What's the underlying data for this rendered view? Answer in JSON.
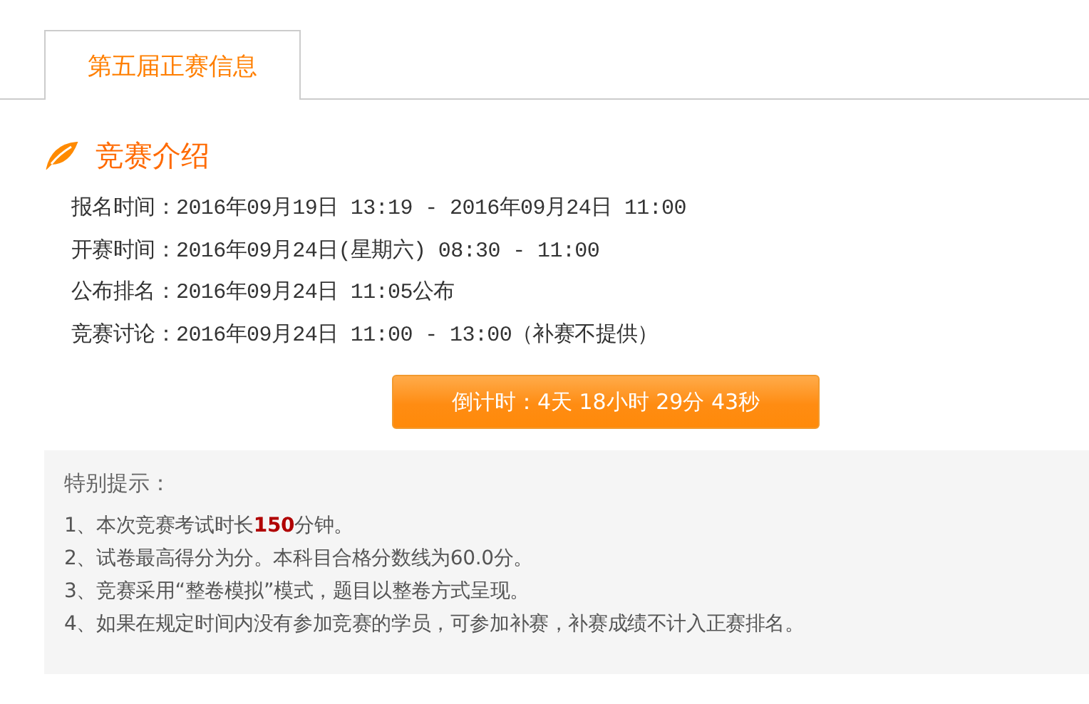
{
  "tabs": [
    {
      "label": "第五届正赛信息",
      "selected": true
    }
  ],
  "section": {
    "title": "竞赛介绍"
  },
  "schedule": [
    {
      "label": "报名时间：",
      "value": "2016年09月19日 13:19 - 2016年09月24日 11:00"
    },
    {
      "label": "开赛时间：",
      "value": "2016年09月24日(星期六) 08:30 - 11:00"
    },
    {
      "label": "公布排名：",
      "value": "2016年09月24日 11:05公布"
    },
    {
      "label": "竞赛讨论：",
      "value": "2016年09月24日 11:00 - 13:00（补赛不提供）"
    }
  ],
  "countdown_button": "倒计时：4天 18小时 29分 43秒",
  "notice": {
    "title": "特别提示：",
    "items": [
      "1、本次竞赛考试时长**150**分钟。",
      "2、试卷最高得分为分。本科目合格分数线为60.0分。",
      "3、竞赛采用“整卷模拟”模式，题目以整卷方式呈现。",
      "4、如果在规定时间内没有参加竞赛的学员，可参加补赛，补赛成绩不计入正赛排名。"
    ]
  }
}
